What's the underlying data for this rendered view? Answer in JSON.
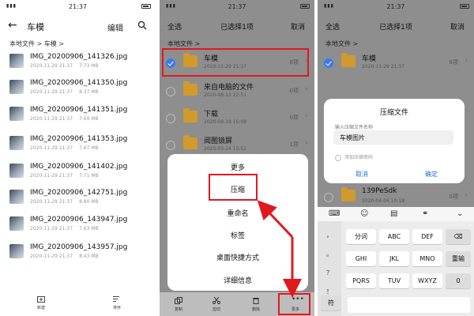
{
  "status": {
    "time": "21:37"
  },
  "panel1": {
    "title": "车模",
    "edit": "编辑",
    "crumb": "本地文件 > 车模 >",
    "files": [
      {
        "name": "IMG_20200906_141326.jpg",
        "date": "2020-11-29 21:37",
        "size": "7.73 MB"
      },
      {
        "name": "IMG_20200906_141350.jpg",
        "date": "2020-11-29 21:37",
        "size": "8.37 MB"
      },
      {
        "name": "IMG_20200906_141351.jpg",
        "date": "2020-11-29 21:37",
        "size": "7.69 MB"
      },
      {
        "name": "IMG_20200906_141353.jpg",
        "date": "2020-11-29 21:37",
        "size": "7.67 MB"
      },
      {
        "name": "IMG_20200906_141402.jpg",
        "date": "2020-11-29 21:37",
        "size": "7.71 MB"
      },
      {
        "name": "IMG_20200906_142751.jpg",
        "date": "2020-11-29 21:37",
        "size": "8.80 MB"
      },
      {
        "name": "IMG_20200906_143947.jpg",
        "date": "2020-11-29 21:37",
        "size": "7.63 MB"
      },
      {
        "name": "IMG_20200906_143957.jpg",
        "date": "2020-11-29 21:37",
        "size": "8.43 MB"
      }
    ],
    "bottom": {
      "new": "新建",
      "sort": "排序"
    }
  },
  "panel2": {
    "select_all": "全选",
    "title": "已选择1项",
    "cancel": "取消",
    "crumb": "本地文件 >",
    "folders": [
      {
        "name": "车模",
        "date": "2020-11-29 21:37",
        "count": "8项"
      },
      {
        "name": "来自电脑的文件",
        "date": "2020-08-13 22:51",
        "count": "0项"
      },
      {
        "name": "下载",
        "date": "2020-09-19 15:08",
        "count": "0项"
      },
      {
        "name": "阅图锁屏",
        "date": "2020-03-24 15:52",
        "count": "1项"
      }
    ],
    "menu": {
      "more": "更多",
      "compress": "压缩",
      "rename": "重命名",
      "tag": "标签",
      "shortcut": "桌面快捷方式",
      "details": "详细信息"
    },
    "bottom": {
      "copy": "复制",
      "cut": "剪切",
      "delete": "删除",
      "more": "更多"
    }
  },
  "panel3": {
    "select_all": "全选",
    "title": "已选择1项",
    "cancel": "取消",
    "crumb": "本地文件 >",
    "folders": [
      {
        "name": "车模",
        "date": "2020-11-29 21:37",
        "count": "8项"
      },
      {
        "name": "139PeSdk",
        "date": "2020-04-04 10:18",
        "count": "0项"
      }
    ],
    "dialog": {
      "title": "压缩文件",
      "label": "输入压缩文件名称",
      "value": "车模图片",
      "add_password": "添加压缩密码",
      "cancel": "取消",
      "ok": "确定"
    },
    "keyboard": {
      "side": [
        "，",
        "。",
        "？",
        "！"
      ],
      "rows": [
        [
          "分词",
          "ABC",
          "DEF"
        ],
        [
          "GHI",
          "JKL",
          "MNO"
        ],
        [
          "PQRS",
          "TUV",
          "WXYZ"
        ]
      ],
      "backspace": "⌫",
      "reinput": "重输",
      "zero": "0",
      "enter": "↵",
      "symbol": "符"
    }
  },
  "colors": {
    "highlight": "#e0191f",
    "selected": "#3a7af0",
    "folder": "#d19a2a"
  }
}
